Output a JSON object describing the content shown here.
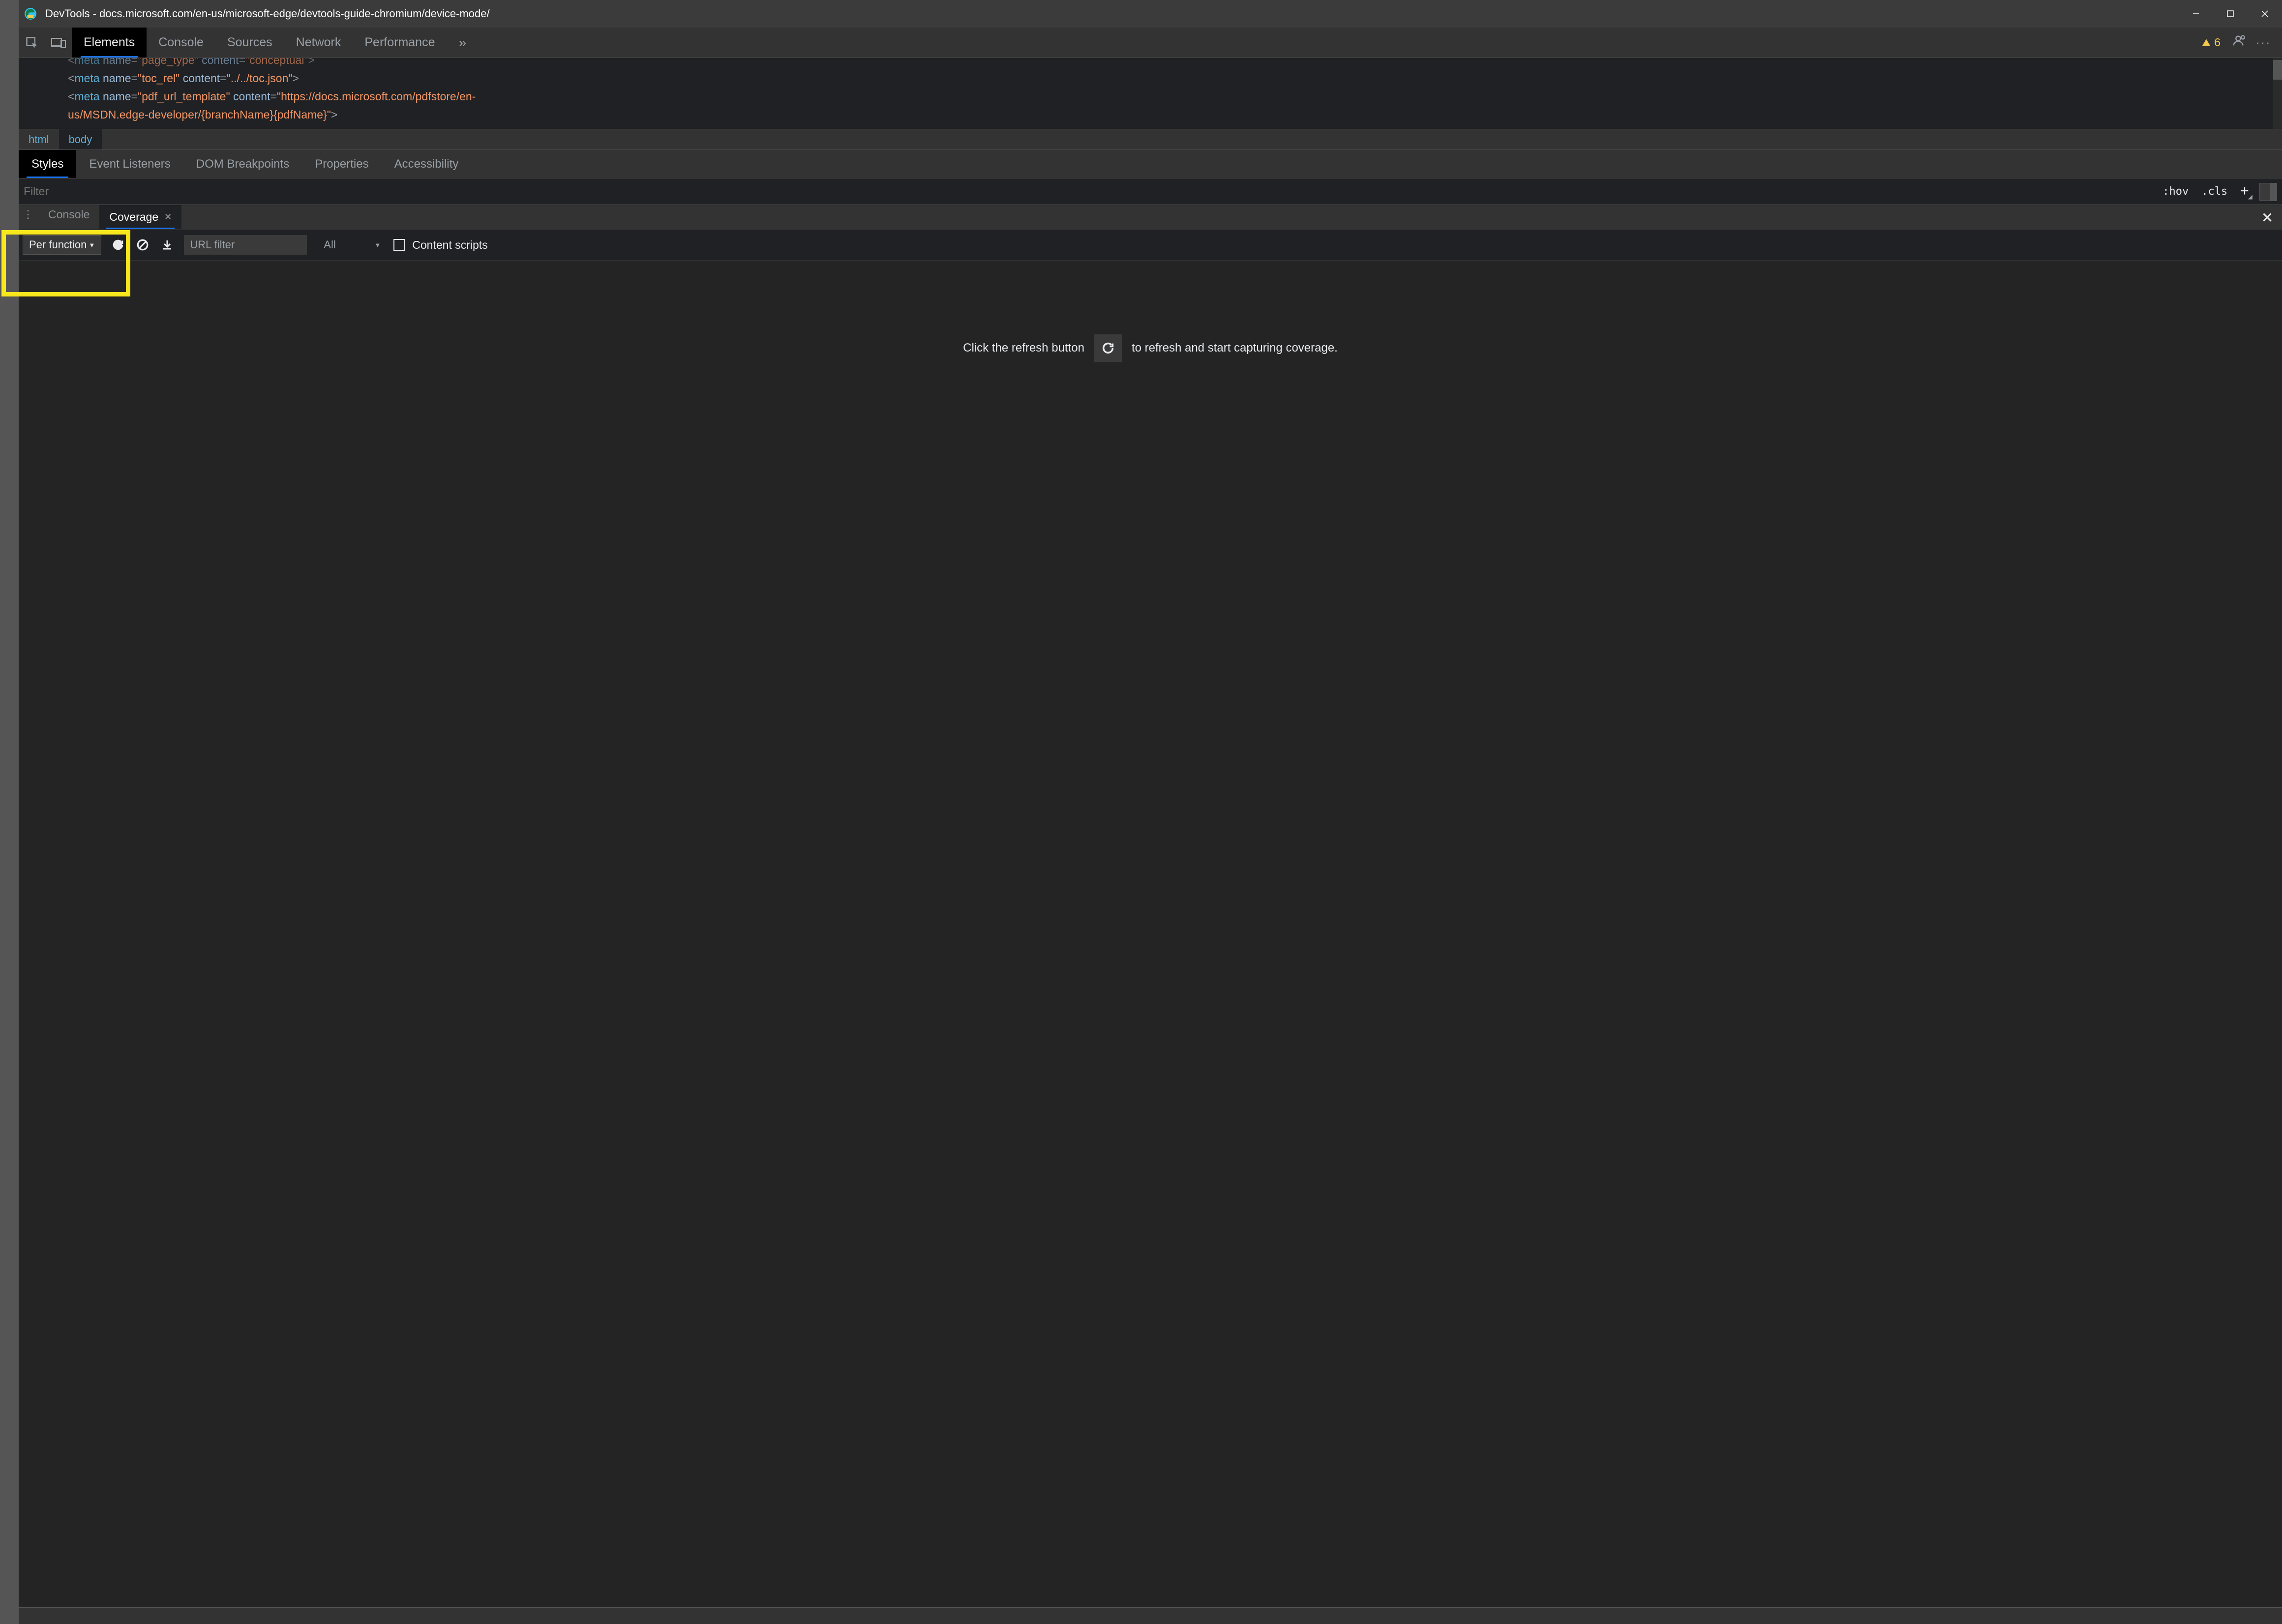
{
  "title": "DevTools - docs.microsoft.com/en-us/microsoft-edge/devtools-guide-chromium/device-mode/",
  "mainTabs": [
    "Elements",
    "Console",
    "Sources",
    "Network",
    "Performance"
  ],
  "mainTabsActive": 0,
  "moreGlyph": "»",
  "warnCount": "6",
  "code": {
    "line0": {
      "pre": "<",
      "tag": "meta",
      "t1": " name",
      "eq1": "=",
      "v1": "\"page_type\"",
      "t2": " content",
      "eq2": "=",
      "v2": "\"conceptual\"",
      "close": ">"
    },
    "line1": {
      "pre": "<",
      "tag": "meta",
      "t1": " name",
      "eq1": "=",
      "v1": "\"toc_rel\"",
      "t2": " content",
      "eq2": "=",
      "v2": "\"../../toc.json\"",
      "close": ">"
    },
    "line2a": {
      "pre": "<",
      "tag": "meta",
      "t1": " name",
      "eq1": "=",
      "v1": "\"pdf_url_template\"",
      "t2": " content",
      "eq2": "=",
      "v2": "\"https://docs.microsoft.com/pdfstore/en-"
    },
    "line2b": {
      "text": "us/MSDN.edge-developer/{branchName}{pdfName}\"",
      "close": ">"
    }
  },
  "crumbs": [
    "html",
    "body"
  ],
  "crumbsActive": 1,
  "subTabs": [
    "Styles",
    "Event Listeners",
    "DOM Breakpoints",
    "Properties",
    "Accessibility"
  ],
  "subTabsActive": 0,
  "styles": {
    "filterPlaceholder": "Filter",
    "hov": ":hov",
    "cls": ".cls"
  },
  "drawer": {
    "drag": "⋮⋮⋮",
    "console": "Console",
    "coverage": "Coverage"
  },
  "coverage": {
    "perFunction": "Per function",
    "urlFilterPlaceholder": "URL filter",
    "typeAll": "All",
    "contentScripts": "Content scripts",
    "msgBefore": "Click the refresh button",
    "msgAfter": "to refresh and start capturing coverage."
  }
}
